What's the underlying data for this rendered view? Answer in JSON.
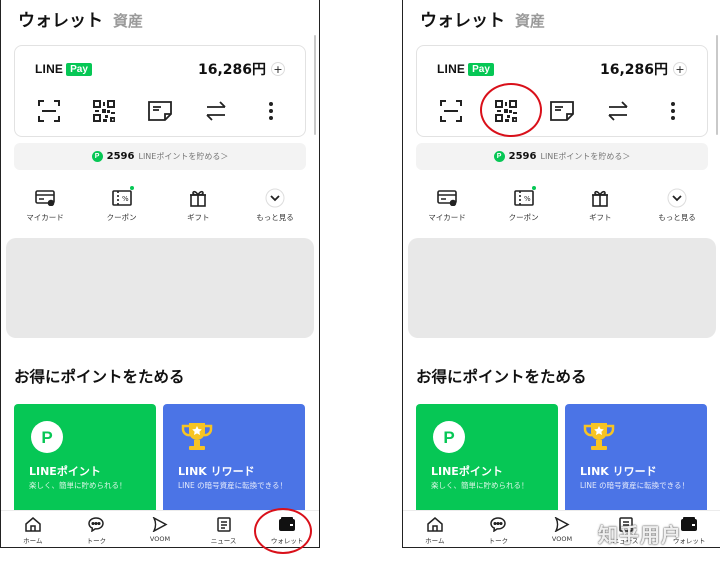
{
  "header": {
    "title": "ウォレット",
    "tab_assets": "資産"
  },
  "pay_card": {
    "logo_line": "LINE",
    "logo_pay": "Pay",
    "balance": "16,286円",
    "add_symbol": "+",
    "actions": [
      "scan-icon",
      "qr-code-icon",
      "pay-code-icon",
      "transfer-icon",
      "more-vertical-icon"
    ]
  },
  "points": {
    "badge": "P",
    "amount": "2596",
    "text": "LINEポイントを貯める＞"
  },
  "quick_menu": [
    {
      "label": "マイカード",
      "icon": "card-icon"
    },
    {
      "label": "クーポン",
      "icon": "coupon-icon",
      "has_dot": true
    },
    {
      "label": "ギフト",
      "icon": "gift-icon"
    },
    {
      "label": "もっと見る",
      "icon": "chevron-down-icon"
    }
  ],
  "section_title": "お得にポイントをためる",
  "cards": [
    {
      "title": "LINEポイント",
      "desc": "楽しく、簡単に貯められる！",
      "icon": "line-points-icon",
      "color": "#06c755"
    },
    {
      "title": "LINK リワード",
      "desc": "LINE の暗号資産に転換できる！",
      "icon": "trophy-icon",
      "color": "#4b74e6"
    }
  ],
  "tabbar": [
    {
      "label": "ホーム",
      "icon": "home-icon"
    },
    {
      "label": "トーク",
      "icon": "chat-icon"
    },
    {
      "label": "VOOM",
      "icon": "voom-icon"
    },
    {
      "label": "ニュース",
      "icon": "news-icon"
    },
    {
      "label": "ウォレット",
      "icon": "wallet-icon"
    }
  ],
  "annotation_color": "#d9101a",
  "watermark": "知乎用户"
}
